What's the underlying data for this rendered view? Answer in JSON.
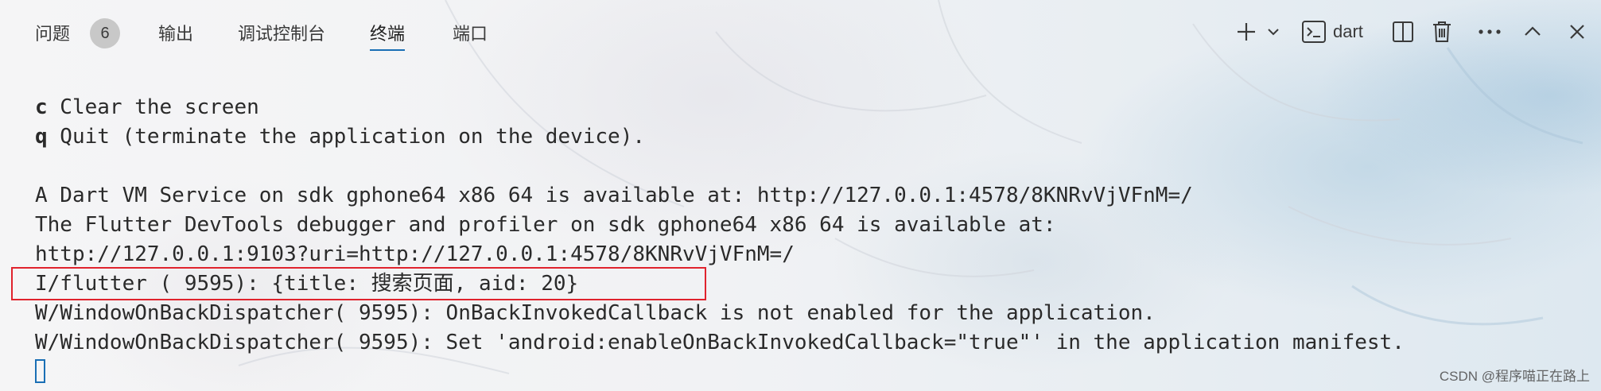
{
  "tabs": [
    {
      "label": "问题",
      "badge": "6"
    },
    {
      "label": "输出"
    },
    {
      "label": "调试控制台"
    },
    {
      "label": "终端",
      "active": true
    },
    {
      "label": "端口"
    }
  ],
  "toolbar": {
    "add_icon": "plus-icon",
    "dropdown_icon": "chevron-down-icon",
    "terminal_icon": "terminal-icon",
    "terminal_name": "dart",
    "split_icon": "split-editor-icon",
    "trash_icon": "trash-icon",
    "more_icon": "more-icon",
    "maximize_icon": "chevron-up-icon",
    "close_icon": "close-icon"
  },
  "terminal": {
    "lines": [
      {
        "key": "c",
        "text": " Clear the screen"
      },
      {
        "key": "q",
        "text": " Quit (terminate the application on the device)."
      },
      {
        "key": "",
        "text": ""
      },
      {
        "key": "",
        "text": "A Dart VM Service on sdk gphone64 x86 64 is available at: http://127.0.0.1:4578/8KNRvVjVFnM=/"
      },
      {
        "key": "",
        "text": "The Flutter DevTools debugger and profiler on sdk gphone64 x86 64 is available at:"
      },
      {
        "key": "",
        "text": "http://127.0.0.1:9103?uri=http://127.0.0.1:4578/8KNRvVjVFnM=/"
      },
      {
        "key": "",
        "text": "I/flutter ( 9595): {title: 搜索页面, aid: 20}"
      },
      {
        "key": "",
        "text": "W/WindowOnBackDispatcher( 9595): OnBackInvokedCallback is not enabled for the application."
      },
      {
        "key": "",
        "text": "W/WindowOnBackDispatcher( 9595): Set 'android:enableOnBackInvokedCallback=\"true\"' in the application manifest."
      }
    ]
  },
  "watermark": "CSDN @程序喵正在路上",
  "colors": {
    "accent": "#1a6fb5",
    "highlight_border": "#e0232d"
  }
}
